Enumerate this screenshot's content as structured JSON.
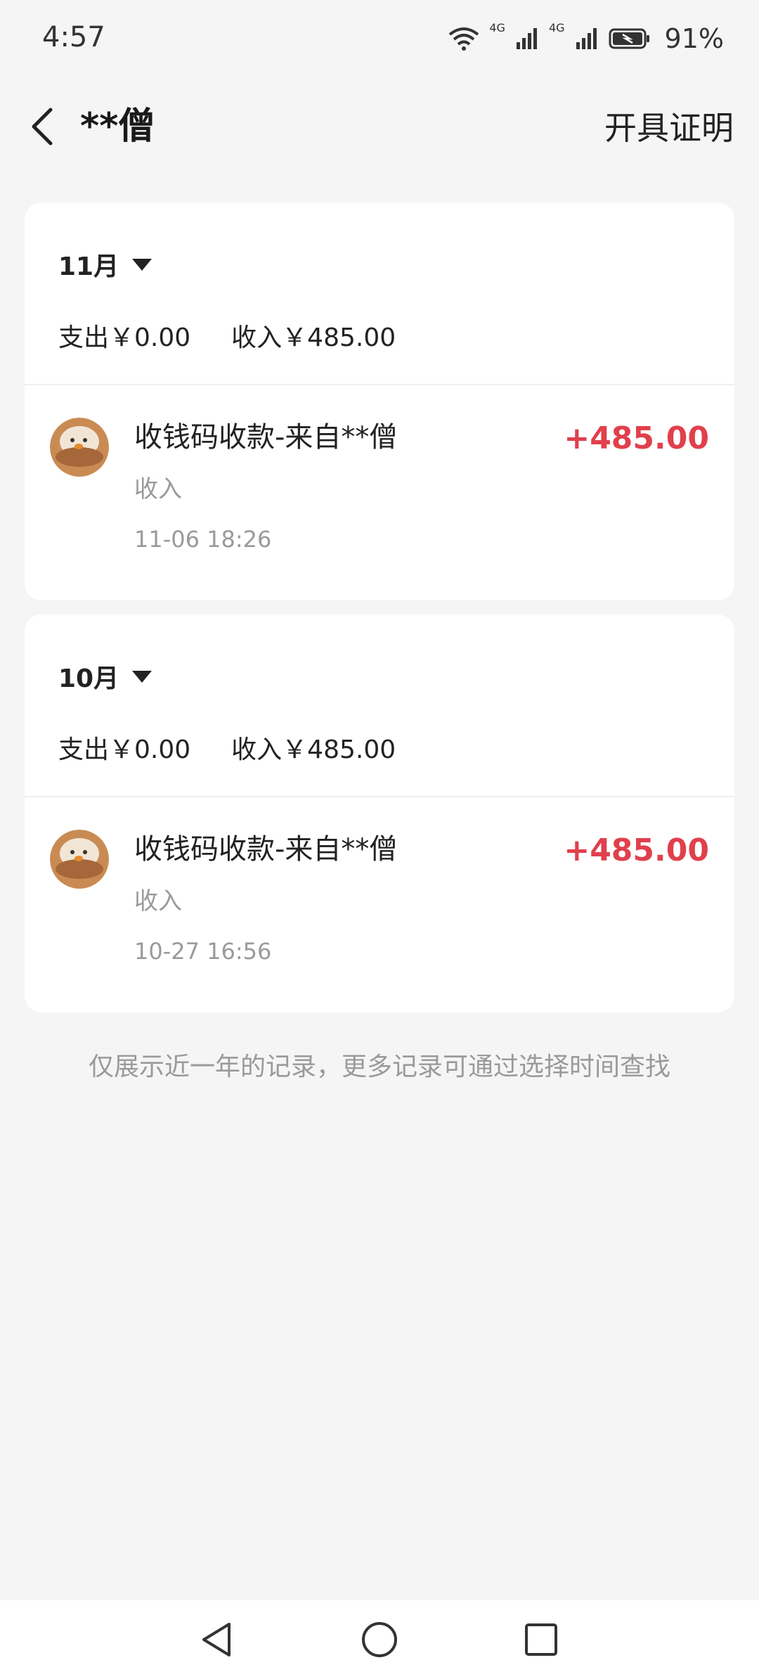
{
  "status": {
    "time": "4:57",
    "battery": "91%",
    "net1": "4G",
    "net2": "4G"
  },
  "header": {
    "title": "**僧",
    "certificate": "开具证明"
  },
  "months": [
    {
      "month": "11月",
      "expense": "支出￥0.00",
      "income": "收入￥485.00",
      "tx": {
        "title": "收钱码收款-来自**僧",
        "type": "收入",
        "time": "11-06 18:26",
        "amount": "+485.00"
      }
    },
    {
      "month": "10月",
      "expense": "支出￥0.00",
      "income": "收入￥485.00",
      "tx": {
        "title": "收钱码收款-来自**僧",
        "type": "收入",
        "time": "10-27 16:56",
        "amount": "+485.00"
      }
    }
  ],
  "footer_note": "仅展示近一年的记录，更多记录可通过选择时间查找",
  "colors": {
    "amount": "#e0404c",
    "background": "#f5f5f5",
    "card": "#ffffff"
  },
  "icons": [
    "wifi-icon",
    "signal-icon",
    "battery-icon",
    "back-arrow-icon",
    "dropdown-triangle-icon",
    "avatar-image",
    "nav-back-icon",
    "nav-home-icon",
    "nav-recents-icon"
  ]
}
